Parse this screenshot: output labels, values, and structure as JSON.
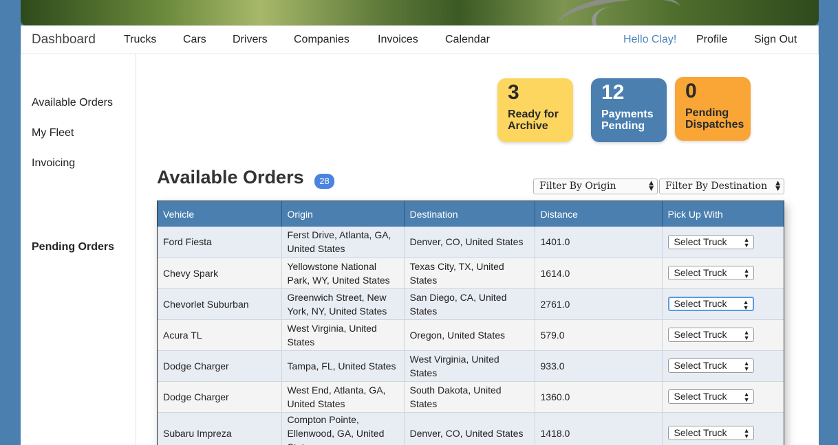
{
  "nav": {
    "brand": "Dashboard",
    "links": [
      "Trucks",
      "Cars",
      "Drivers",
      "Companies",
      "Invoices",
      "Calendar"
    ],
    "greeting": "Hello Clay!",
    "profile": "Profile",
    "sign_out": "Sign Out"
  },
  "sidebar": {
    "items": [
      "Available Orders",
      "My Fleet",
      "Invoicing"
    ],
    "pending": "Pending Orders"
  },
  "cards": [
    {
      "number": "3",
      "label1": "Ready for",
      "label2": "Archive"
    },
    {
      "number": "12",
      "label1": "Payments",
      "label2": "Pending"
    },
    {
      "number": "0",
      "label1": "Pending",
      "label2": "Dispatches"
    }
  ],
  "orders": {
    "title": "Available Orders",
    "count": "28",
    "filter_origin": "Filter By Origin",
    "filter_destination": "Filter By Destination",
    "columns": [
      "Vehicle",
      "Origin",
      "Destination",
      "Distance",
      "Pick Up With"
    ],
    "select_label": "Select Truck",
    "rows": [
      {
        "vehicle": "Ford Fiesta",
        "origin": "Ferst Drive, Atlanta, GA, United States",
        "destination": "Denver, CO, United States",
        "distance": "1401.0"
      },
      {
        "vehicle": "Chevy Spark",
        "origin": "Yellowstone National Park, WY, United States",
        "destination": "Texas City, TX, United States",
        "distance": "1614.0"
      },
      {
        "vehicle": "Chevorlet Suburban",
        "origin": "Greenwich Street, New York, NY, United States",
        "destination": "San Diego, CA, United States",
        "distance": "2761.0"
      },
      {
        "vehicle": "Acura TL",
        "origin": "West Virginia, United States",
        "destination": "Oregon, United States",
        "distance": "579.0"
      },
      {
        "vehicle": "Dodge Charger",
        "origin": "Tampa, FL, United States",
        "destination": "West Virginia, United States",
        "distance": "933.0"
      },
      {
        "vehicle": "Dodge Charger",
        "origin": "West End, Atlanta, GA, United States",
        "destination": "South Dakota, United States",
        "distance": "1360.0"
      },
      {
        "vehicle": "Subaru Impreza",
        "origin": "Compton Pointe, Ellenwood, GA, United States",
        "destination": "Denver, CO, United States",
        "distance": "1418.0"
      }
    ]
  }
}
